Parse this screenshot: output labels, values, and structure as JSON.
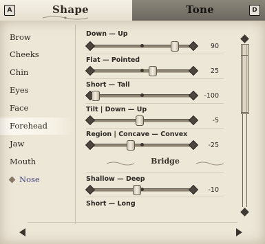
{
  "tabs": [
    {
      "label": "Shape",
      "hotkey": "A",
      "selected": true
    },
    {
      "label": "Tone",
      "hotkey": "D",
      "selected": false
    }
  ],
  "sidebar": {
    "items": [
      {
        "label": "Brow"
      },
      {
        "label": "Cheeks"
      },
      {
        "label": "Chin"
      },
      {
        "label": "Eyes"
      },
      {
        "label": "Face"
      },
      {
        "label": "Forehead",
        "selected": true
      },
      {
        "label": "Jaw"
      },
      {
        "label": "Mouth"
      },
      {
        "label": "Nose",
        "bullet": "diamond-icon"
      }
    ]
  },
  "sliders": [
    {
      "label": "Down — Up",
      "value": "90",
      "fraction": 0.86
    },
    {
      "label": "Flat — Pointed",
      "value": "25",
      "fraction": 0.62
    },
    {
      "label": "Short — Tall",
      "value": "-100",
      "fraction": 0.0
    },
    {
      "label": "Tilt | Down — Up",
      "value": "-5",
      "fraction": 0.48
    },
    {
      "label": "Region | Concave — Convex",
      "value": "-25",
      "fraction": 0.38
    }
  ],
  "section": {
    "label": "Bridge"
  },
  "bridge_sliders": [
    {
      "label": "Shallow — Deep",
      "value": "-10",
      "fraction": 0.45
    },
    {
      "label": "Short — Long"
    }
  ],
  "footer": {
    "left_hotkey": "",
    "right_hotkey": ""
  },
  "colors": {
    "panel": "#ede7d8",
    "accent_text": "#3c3f78",
    "header_dark": "#6c6860"
  }
}
